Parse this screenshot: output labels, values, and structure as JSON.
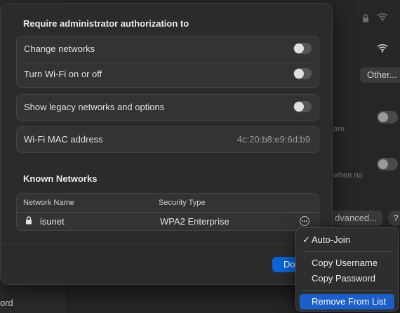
{
  "background": {
    "other_button": "Other...",
    "advanced_button": "dvanced...",
    "help_button": "?",
    "sidebar_partial_text": "ord",
    "partial_text_1": "are",
    "partial_text_2": "when no"
  },
  "sheet": {
    "auth_section_title": "Require administrator authorization to",
    "auth_options": [
      {
        "label": "Change networks",
        "enabled": false
      },
      {
        "label": "Turn Wi-Fi on or off",
        "enabled": false
      }
    ],
    "legacy_option": {
      "label": "Show legacy networks and options",
      "enabled": false
    },
    "mac_address": {
      "label": "Wi-Fi MAC address",
      "value": "4c:20:b8:e9:6d:b9"
    },
    "known_networks_title": "Known Networks",
    "table": {
      "columns": [
        "Network Name",
        "Security Type"
      ],
      "rows": [
        {
          "name": "isunet",
          "security": "WPA2 Enterprise",
          "icon": "lock-icon"
        }
      ]
    },
    "done_button": "Do"
  },
  "context_menu": {
    "items": [
      {
        "label": "Auto-Join",
        "checked": true
      },
      {
        "label": "Copy Username"
      },
      {
        "label": "Copy Password"
      },
      {
        "label": "Remove From List",
        "highlighted": true
      }
    ]
  },
  "colors": {
    "accent": "#0a64d6",
    "menu_highlight": "#1a5ec9"
  }
}
